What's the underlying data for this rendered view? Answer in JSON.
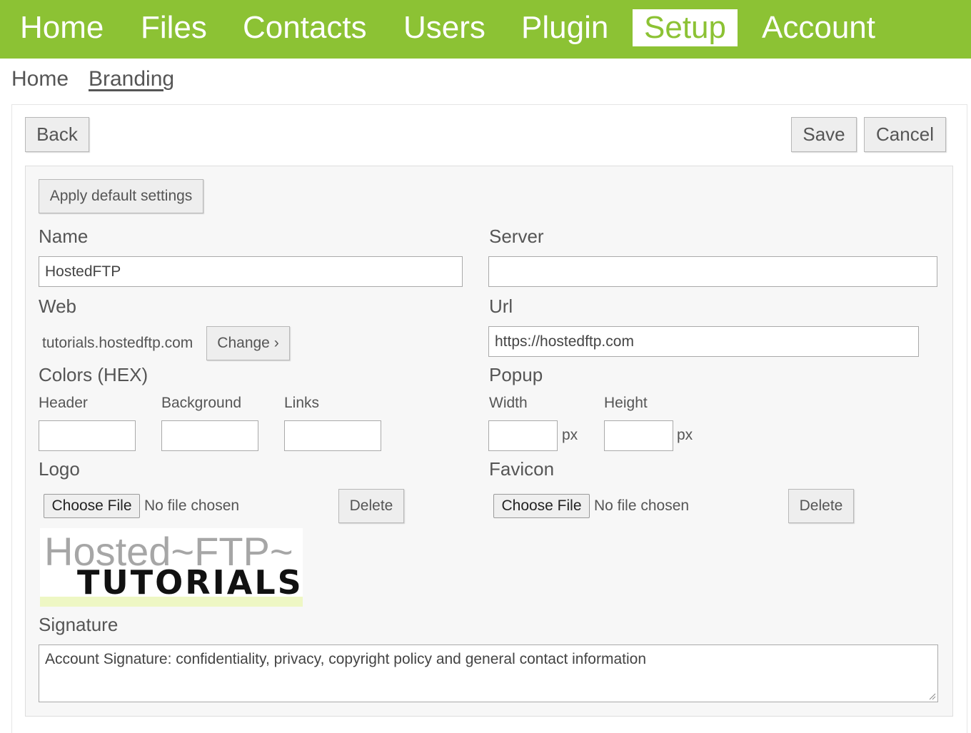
{
  "nav": {
    "items": [
      "Home",
      "Files",
      "Contacts",
      "Users",
      "Plugin",
      "Setup",
      "Account"
    ],
    "active": "Setup"
  },
  "breadcrumb": {
    "home": "Home",
    "current": "Branding"
  },
  "toolbar": {
    "back": "Back",
    "save": "Save",
    "cancel": "Cancel"
  },
  "form": {
    "apply_default": "Apply default settings",
    "name_label": "Name",
    "name_value": "HostedFTP",
    "server_label": "Server",
    "server_value": "",
    "web_label": "Web",
    "web_value": "tutorials.hostedftp.com",
    "change_button": "Change ›",
    "url_label": "Url",
    "url_value": "https://hostedftp.com",
    "colors_label": "Colors (HEX)",
    "header_label": "Header",
    "background_label": "Background",
    "links_label": "Links",
    "popup_label": "Popup",
    "width_label": "Width",
    "height_label": "Height",
    "px_unit": "px",
    "logo_label": "Logo",
    "favicon_label": "Favicon",
    "choose_file": "Choose File",
    "no_file": "No file chosen",
    "delete": "Delete",
    "signature_label": "Signature",
    "signature_value": "Account Signature: confidentiality, privacy, copyright policy and general contact information"
  },
  "logo": {
    "line1": "Hosted~FTP~",
    "line2": "TUTORIALS"
  },
  "colors": {
    "accent": "#8cc234",
    "panel": "#f7f7f7"
  }
}
